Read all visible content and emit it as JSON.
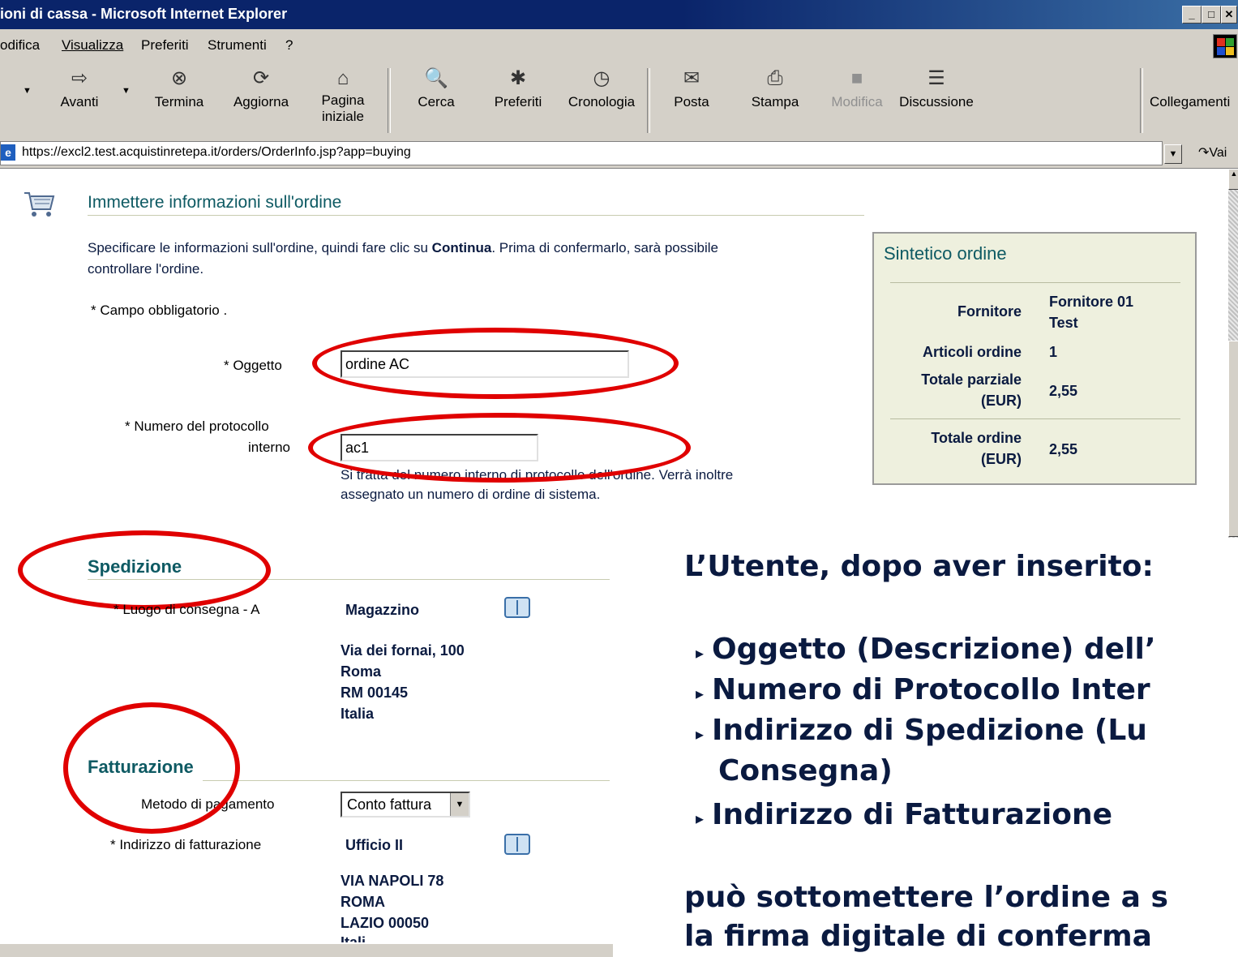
{
  "window": {
    "title": "ioni di cassa - Microsoft Internet Explorer",
    "buttons": {
      "minimize": "_",
      "maximize": "□",
      "close": "✕"
    }
  },
  "menu": [
    {
      "label": "odifica"
    },
    {
      "label": "Visualizza"
    },
    {
      "label": "Preferiti"
    },
    {
      "label": "Strumenti"
    },
    {
      "label": "?"
    }
  ],
  "toolbar": {
    "buttons": [
      {
        "label": "Avanti",
        "icon": "forward-arrow-icon",
        "glyph": "⇨"
      },
      {
        "label": "Termina",
        "icon": "stop-icon",
        "glyph": "⊗"
      },
      {
        "label": "Aggiorna",
        "icon": "refresh-icon",
        "glyph": "⟳"
      },
      {
        "label": "Pagina\niniziale",
        "icon": "home-icon",
        "glyph": "⌂"
      },
      {
        "label": "Cerca",
        "icon": "search-icon",
        "glyph": "🔍"
      },
      {
        "label": "Preferiti",
        "icon": "favorites-icon",
        "glyph": "✱"
      },
      {
        "label": "Cronologia",
        "icon": "history-icon",
        "glyph": "◷"
      },
      {
        "label": "Posta",
        "icon": "mail-icon",
        "glyph": "✉"
      },
      {
        "label": "Stampa",
        "icon": "print-icon",
        "glyph": "⎙"
      },
      {
        "label": "Modifica",
        "icon": "edit-icon",
        "glyph": "■"
      },
      {
        "label": "Discussione",
        "icon": "discussion-icon",
        "glyph": "☰"
      }
    ],
    "links_label": "Collegamenti"
  },
  "address": {
    "url": "https://excl2.test.acquistinretepa.it/orders/OrderInfo.jsp?app=buying",
    "go_label": "Vai"
  },
  "page": {
    "heading": "Immettere informazioni sull'ordine",
    "intro_pre": "Specificare le informazioni sull'ordine, quindi fare clic su ",
    "intro_bold": "Continua",
    "intro_post": ". Prima di confermarlo, sarà possibile",
    "intro_line2": "controllare l'ordine.",
    "required_note": "* Campo obbligatorio .",
    "oggetto_label": "* Oggetto",
    "oggetto_value": "ordine AC",
    "protocollo_label_1": "* Numero del protocollo",
    "protocollo_label_2": "interno",
    "protocollo_value": "ac1",
    "protocollo_help_1": "Si tratta del numero interno di protocollo dell'ordine. Verrà inoltre",
    "protocollo_help_2": "assegnato un numero di ordine di sistema.",
    "spedizione_title": "Spedizione",
    "luogo_label": "* Luogo di consegna - A",
    "luogo_name": "Magazzino",
    "luogo_addr": [
      "Via dei fornai, 100",
      "Roma",
      "RM 00145",
      "Italia"
    ],
    "fatturazione_title": "Fatturazione",
    "metodo_label": "Metodo di pagamento",
    "metodo_value": "Conto fattura",
    "indirizzo_fatt_label": "* Indirizzo di fatturazione",
    "indirizzo_fatt_name": "Ufficio II",
    "indirizzo_fatt_addr": [
      "VIA NAPOLI 78",
      "ROMA",
      "LAZIO 00050",
      "Itali"
    ]
  },
  "summary": {
    "title": "Sintetico ordine",
    "fornitore_label": "Fornitore",
    "fornitore_value_1": "Fornitore 01",
    "fornitore_value_2": "Test",
    "articoli_label": "Articoli ordine",
    "articoli_value": "1",
    "parziale_label_1": "Totale parziale",
    "parziale_label_2": "(EUR)",
    "parziale_value": "2,55",
    "totale_label_1": "Totale ordine",
    "totale_label_2": "(EUR)",
    "totale_value": "2,55"
  },
  "slide": {
    "intro": "L’Utente, dopo aver inserito:",
    "bullets": [
      "Oggetto (Descrizione) dell’",
      "Numero di Protocollo Inter",
      "Indirizzo di Spedizione (Lu",
      "Consegna)",
      "Indirizzo di Fatturazione"
    ],
    "outro_1": "può sottomettere l’ordine a s",
    "outro_2": "la firma digitale di conferma"
  },
  "colors": {
    "highlight": "#e00000",
    "teal_heading": "#0e5a63",
    "summary_bg": "#eef0de",
    "slide_text": "#0a1a40"
  }
}
